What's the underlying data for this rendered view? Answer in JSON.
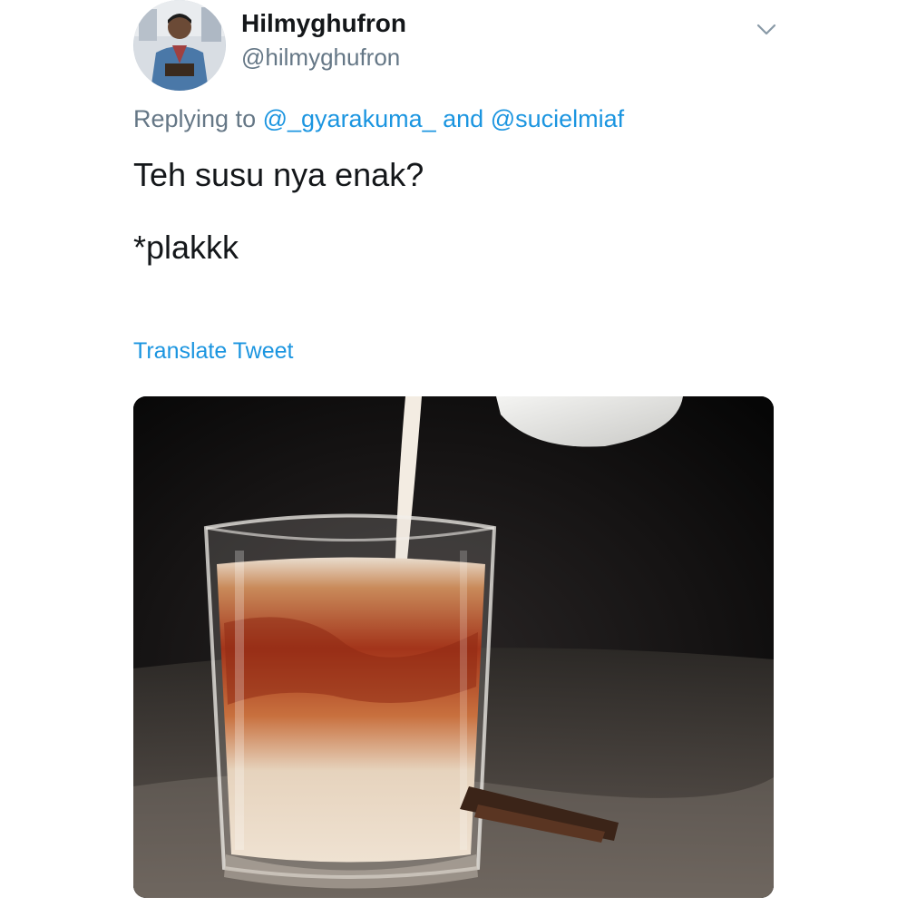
{
  "tweet": {
    "author": {
      "display_name": "Hilmyghufron",
      "handle": "@hilmyghufron",
      "avatar_icon": "user-photo-avatar"
    },
    "menu_icon": "chevron-down-icon",
    "replying_to": {
      "prefix": "Replying to",
      "mentions": [
        "@_gyarakuma_",
        "@sucielmiaf"
      ],
      "conjunction": "and"
    },
    "text_lines": [
      "Teh susu nya enak?",
      "*plakkk"
    ],
    "translate_label": "Translate Tweet",
    "media": {
      "type": "photo",
      "subject": "milk-tea-glass-photo"
    }
  },
  "colors": {
    "link": "#1b95e0",
    "secondary_text": "#657786",
    "primary_text": "#14171a",
    "background": "#ffffff"
  }
}
